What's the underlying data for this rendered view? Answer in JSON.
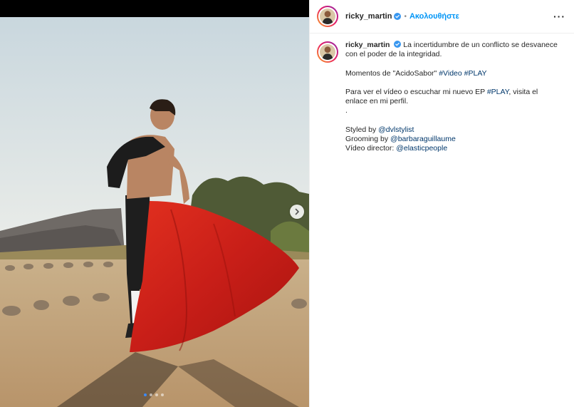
{
  "header": {
    "username": "ricky_martin",
    "separator": "•",
    "follow_label": "Ακολουθήστε",
    "more_label": "···"
  },
  "caption": {
    "username": "ricky_martin",
    "line1": "La incertidumbre de un conflicto se desvanece con el poder de la integridad.",
    "moments_text": "Momentos de \"AcidoSabor\" ",
    "hashtag_video": "#Video",
    "hashtag_play": "#PLAY",
    "para3_before": "Para ver el vídeo o escuchar mi nuevo EP ",
    "para3_hashtag": "#PLAY",
    "para3_after": ", visita el enlace en mi perfil.",
    "dot_line": ".",
    "styled_by_label": "Styled by ",
    "styled_by_handle": "@dvlstylist",
    "grooming_label": "Grooming by ",
    "grooming_handle": "@barbaraguillaume",
    "director_label": "Vídeo director: ",
    "director_handle": "@elasticpeople"
  },
  "carousel": {
    "total": 4,
    "active_index": 0
  },
  "colors": {
    "link": "#00376b",
    "follow": "#0095f6",
    "verified": "#3897f0",
    "dot_active": "#3d8af7"
  },
  "icons": {
    "next": "chevron-right-icon",
    "verified": "verified-badge-icon",
    "more": "more-options-icon"
  }
}
